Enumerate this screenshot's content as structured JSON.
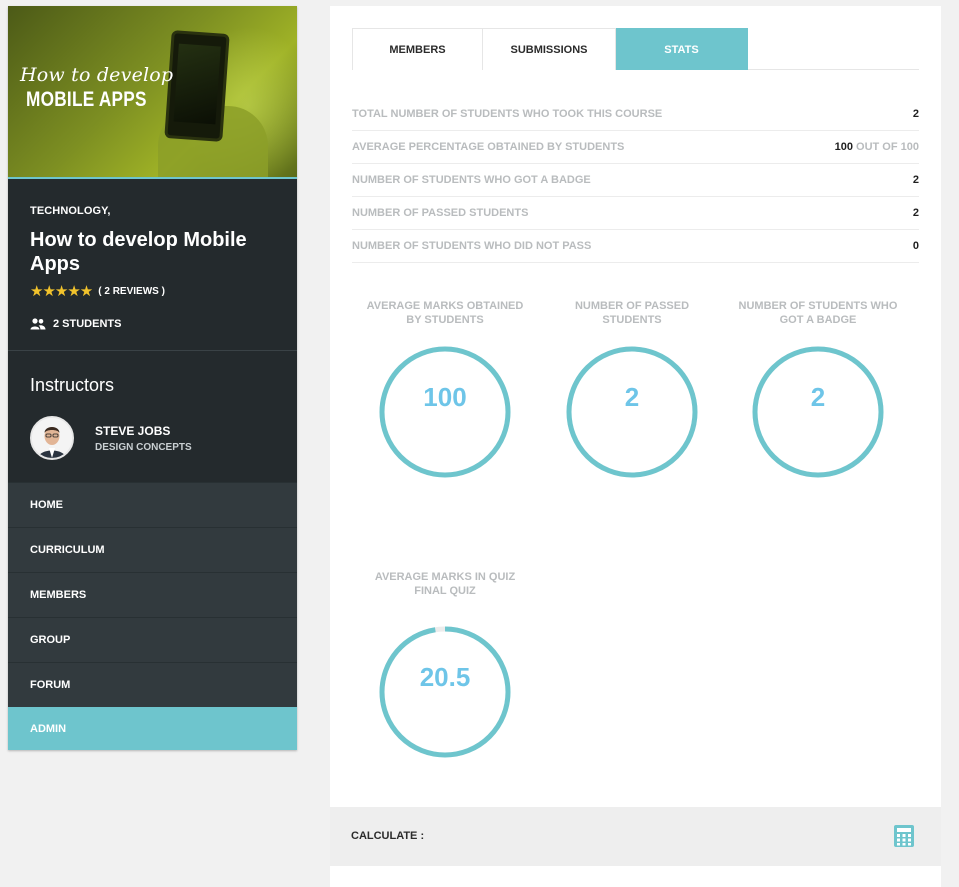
{
  "sidebar": {
    "hero": {
      "script_text": "How to develop",
      "bold_text": "MOBILE APPS"
    },
    "category": "TECHNOLOGY,",
    "course_title": "How to develop Mobile Apps",
    "rating": {
      "stars": "★★★★★",
      "reviews": "( 2 REVIEWS )"
    },
    "students": "2 STUDENTS",
    "instructors_heading": "Instructors",
    "instructor": {
      "name": "STEVE JOBS",
      "subtitle": "DESIGN CONCEPTS"
    },
    "nav": [
      {
        "label": "HOME"
      },
      {
        "label": "CURRICULUM"
      },
      {
        "label": "MEMBERS"
      },
      {
        "label": "GROUP"
      },
      {
        "label": "FORUM"
      },
      {
        "label": "ADMIN"
      }
    ],
    "active_nav": "ADMIN"
  },
  "main": {
    "tabs": [
      {
        "label": "MEMBERS"
      },
      {
        "label": "SUBMISSIONS"
      },
      {
        "label": "STATS"
      }
    ],
    "active_tab": "STATS",
    "stats": [
      {
        "label": "TOTAL NUMBER OF STUDENTS WHO TOOK THIS COURSE",
        "value": "2"
      },
      {
        "label": "AVERAGE PERCENTAGE OBTAINED BY STUDENTS",
        "value": "100",
        "suffix": "OUT OF 100"
      },
      {
        "label": "NUMBER OF STUDENTS WHO GOT A BADGE",
        "value": "2"
      },
      {
        "label": "NUMBER OF PASSED STUDENTS",
        "value": "2"
      },
      {
        "label": "NUMBER OF STUDENTS WHO DID NOT PASS",
        "value": "0"
      }
    ],
    "circles": [
      {
        "label_line1": "AVERAGE MARKS OBTAINED",
        "label_line2": "BY STUDENTS",
        "value": "100",
        "fill": 1.0
      },
      {
        "label_line1": "NUMBER OF PASSED",
        "label_line2": "STUDENTS",
        "value": "2",
        "fill": 1.0
      },
      {
        "label_line1": "NUMBER OF STUDENTS WHO",
        "label_line2": "GOT A BADGE",
        "value": "2",
        "fill": 1.0
      },
      {
        "label_line1": "AVERAGE MARKS IN QUIZ",
        "label_line2": "FINAL QUIZ",
        "value": "20.5",
        "fill": 0.975
      }
    ],
    "calculate_label": "CALCULATE :"
  },
  "colors": {
    "accent": "#6ec5cd",
    "value_text": "#6ec5e8",
    "sidebar_bg": "#242a2d",
    "nav_bg": "#323a3e",
    "muted_text": "#b9bcbe",
    "star": "#f2c32c"
  },
  "icons": {
    "students": "users-icon",
    "calculate": "calculator-icon"
  }
}
